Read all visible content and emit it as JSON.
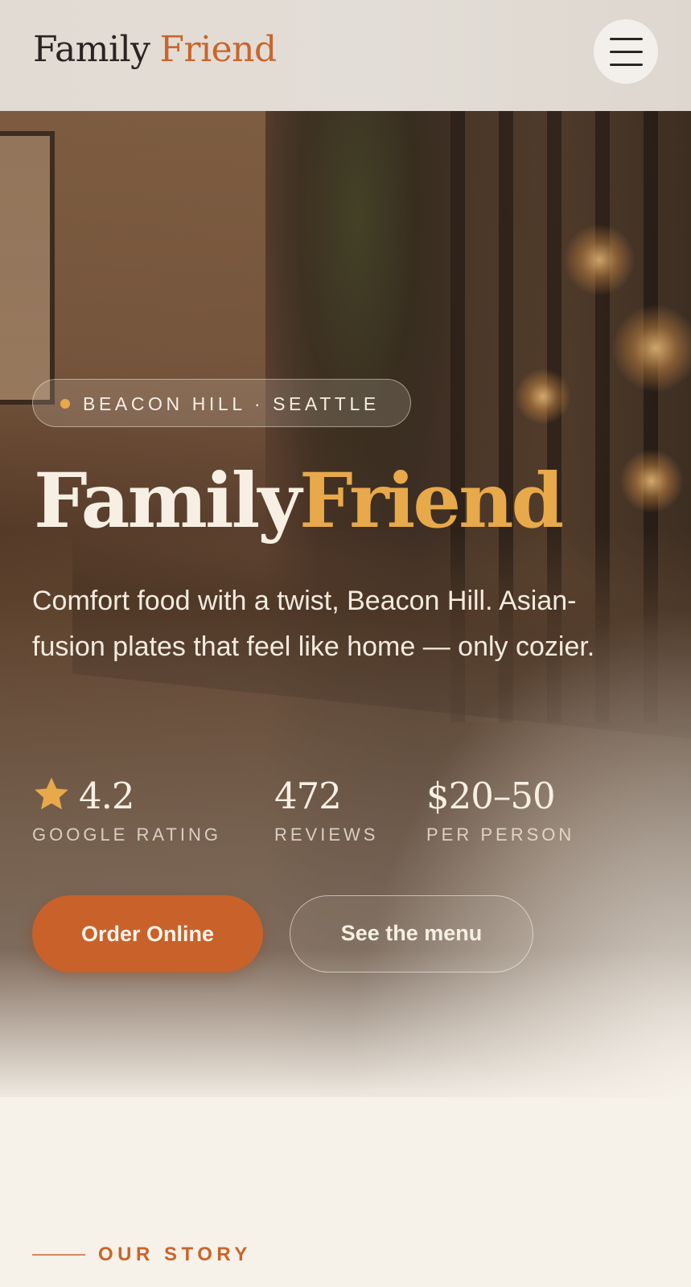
{
  "header": {
    "logo_word1": "Family",
    "logo_word2": "Friend",
    "menu_icon": "hamburger-menu-icon"
  },
  "hero": {
    "location": "BEACON HILL · SEATTLE",
    "title_word1": "Family",
    "title_word2": "Friend",
    "tagline": "Comfort food with a twist, Beacon Hill. Asian-fusion plates that feel like home — only cozier.",
    "stats": {
      "rating": {
        "value": "4.2",
        "label": "GOOGLE RATING",
        "icon": "star-icon"
      },
      "reviews": {
        "value": "472",
        "label": "REVIEWS"
      },
      "price": {
        "value": "$20–50",
        "label": "PER PERSON"
      }
    },
    "buttons": {
      "order": "Order Online",
      "menu": "See the menu"
    }
  },
  "story": {
    "eyebrow": "OUR STORY"
  },
  "colors": {
    "accent": "#c9652a",
    "gold": "#e8a94a",
    "background": "#f6f1e9",
    "ink": "#2a2522"
  }
}
